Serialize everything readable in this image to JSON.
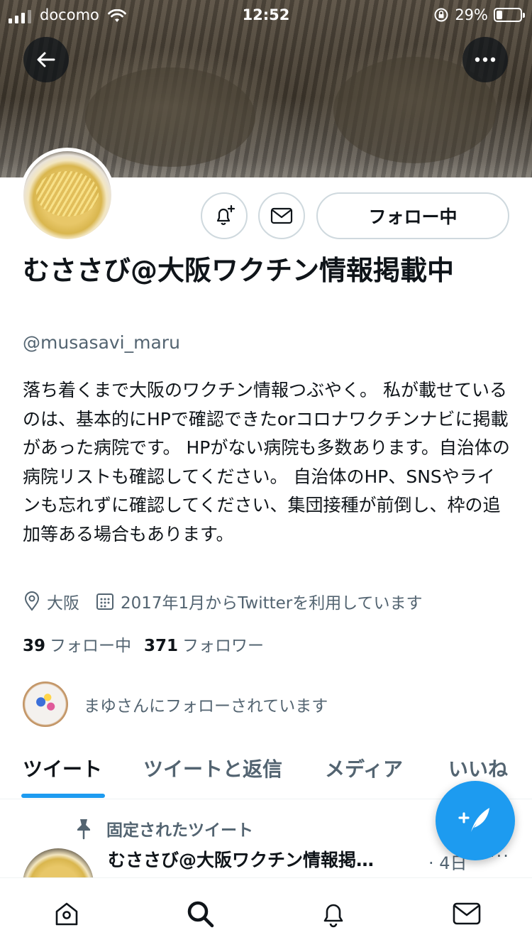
{
  "status_bar": {
    "carrier": "docomo",
    "time": "12:52",
    "battery": "29%"
  },
  "profile": {
    "display_name": "むささび@大阪ワクチン情報掲載中",
    "handle": "@musasavi_maru",
    "follow_button_label": "フォロー中",
    "bio": "落ち着くまで大阪のワクチン情報つぶやく。 私が載せているのは、基本的にHPで確認できたorコロナワクチンナビに掲載があった病院です。 HPがない病院も多数あります。自治体の病院リストも確認してください。 自治体のHP、SNSやラインも忘れずに確認してください、集団接種が前倒し、枠の追加等ある場合もあります。",
    "location": "大阪",
    "joined": "2017年1月からTwitterを利用しています",
    "following_count": "39",
    "following_label": "フォロー中",
    "followers_count": "371",
    "followers_label": "フォロワー",
    "followed_by_text": "まゆさんにフォローされています"
  },
  "tabs": [
    {
      "label": "ツイート",
      "active": true
    },
    {
      "label": "ツイートと返信",
      "active": false
    },
    {
      "label": "メディア",
      "active": false
    },
    {
      "label": "いいね",
      "active": false
    }
  ],
  "pinned_tweet": {
    "label": "固定されたツイート",
    "author": "むささび@大阪ワクチン情報掲…",
    "time": "· 4日",
    "more": "···"
  },
  "icons": {
    "back": "back-arrow-icon",
    "more": "more-icon",
    "notify": "bell-plus-icon",
    "message": "envelope-icon",
    "location": "location-pin-icon",
    "calendar": "calendar-icon",
    "pin": "pin-icon",
    "compose": "compose-tweet-icon",
    "nav": [
      "home-icon",
      "search-icon",
      "notifications-icon",
      "messages-icon"
    ]
  },
  "colors": {
    "accent": "#1d9bf0",
    "text_primary": "#0f1419",
    "text_secondary": "#536471",
    "border": "#cfd9de"
  }
}
